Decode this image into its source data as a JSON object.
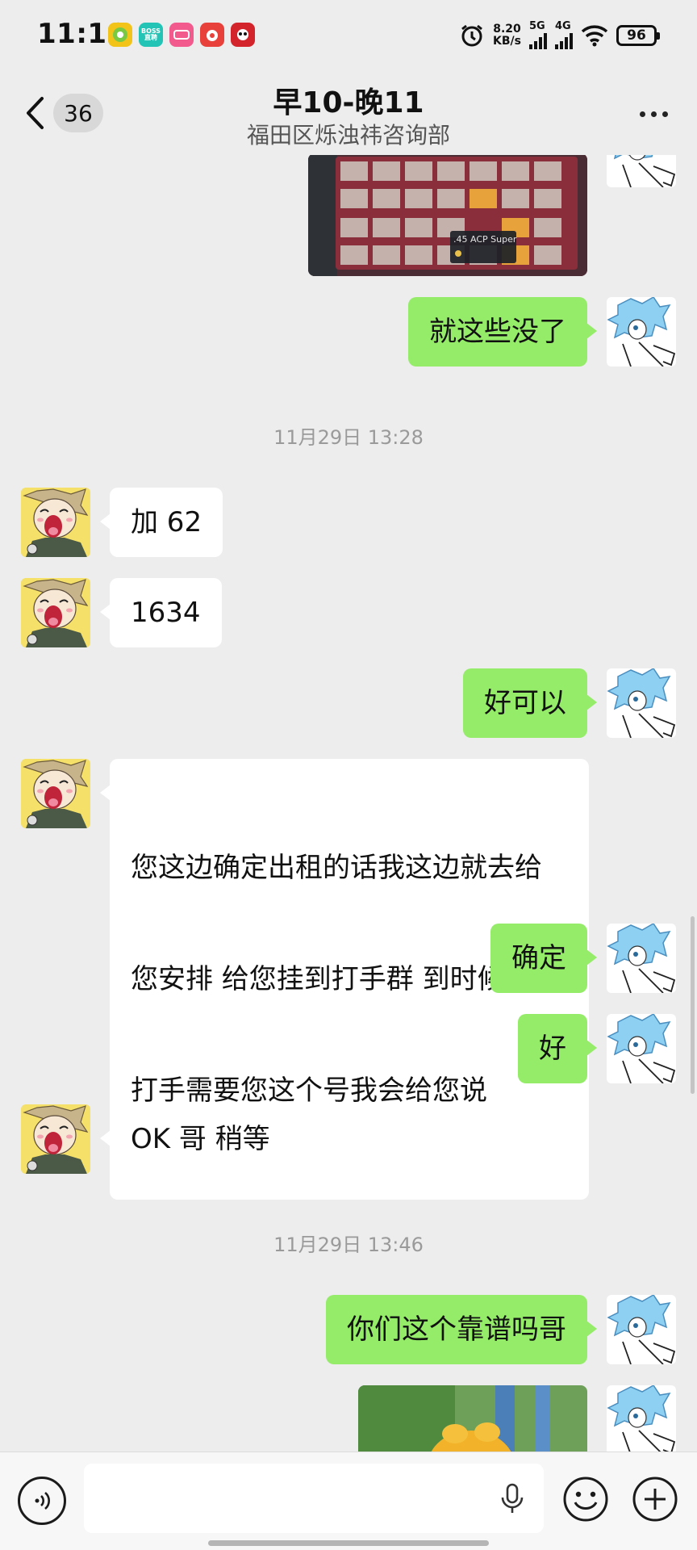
{
  "status_bar": {
    "time": "11:16",
    "apps": [
      {
        "name": "app-icon-1",
        "color": "#f2c318",
        "label": ""
      },
      {
        "name": "app-icon-boss",
        "color": "#23c3b5",
        "label": "BOSS直聘"
      },
      {
        "name": "app-icon-3",
        "color": "#f25a8e",
        "label": ""
      },
      {
        "name": "app-icon-4",
        "color": "#e8403a",
        "label": ""
      },
      {
        "name": "app-icon-5",
        "color": "#d4242b",
        "label": ""
      }
    ],
    "net_speed_value": "8.20",
    "net_speed_unit": "KB/s",
    "signal1_label": "5G",
    "signal2_label": "4G",
    "battery": "96"
  },
  "header": {
    "back_count": "36",
    "title": "早10-晚11",
    "subtitle": "福田区烁浊祎咨询部"
  },
  "messages": [
    {
      "type": "image",
      "side": "right",
      "image_text": ".45 ACP Super"
    },
    {
      "type": "text",
      "side": "right",
      "text": "就这些没了"
    },
    {
      "type": "timestamp",
      "text": "11月29日 13:28"
    },
    {
      "type": "text",
      "side": "left",
      "text": "加 62"
    },
    {
      "type": "text",
      "side": "left",
      "text": "1634"
    },
    {
      "type": "text",
      "side": "right",
      "text": "好可以"
    },
    {
      "type": "text",
      "side": "left",
      "lines": [
        "您这边确定出租的话我这边就去给",
        "您安排 给您挂到打手群 到时候有",
        "打手需要您这个号我会给您说"
      ]
    },
    {
      "type": "text",
      "side": "right",
      "text": "确定"
    },
    {
      "type": "text",
      "side": "right",
      "text": "好"
    },
    {
      "type": "text",
      "side": "left",
      "text": "OK 哥 稍等"
    },
    {
      "type": "timestamp",
      "text": "11月29日 13:46"
    },
    {
      "type": "text",
      "side": "right",
      "text": "你们这个靠谱吗哥"
    },
    {
      "type": "image",
      "side": "right"
    }
  ],
  "input_bar": {
    "placeholder": ""
  },
  "colors": {
    "background": "#ededed",
    "sent_bubble": "#95ec69",
    "received_bubble": "#ffffff"
  }
}
